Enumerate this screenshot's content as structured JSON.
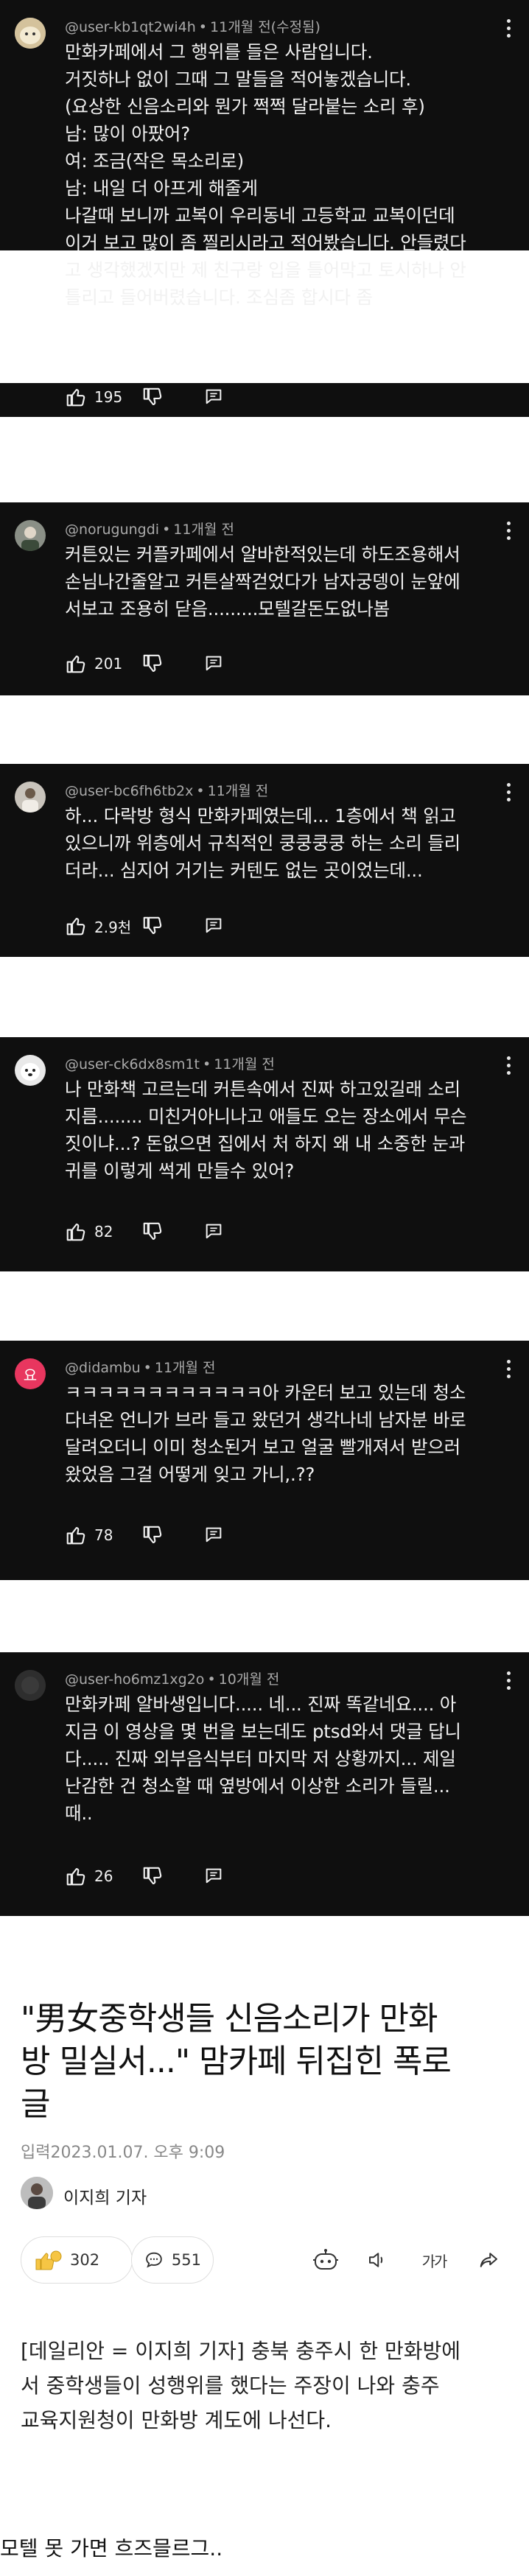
{
  "comments": [
    {
      "handle": "@user-kb1qt2wi4h",
      "time": "11개월 전(수정됨)",
      "lines": [
        "만화카페에서 그 행위를 들은 사람입니다.",
        "거짓하나 없이 그때 그 말들을 적어놓겠습니다.",
        "(요상한 신음소리와 뭔가 쩍쩍 달라붙는 소리 후)",
        "남: 많이 아팠어?",
        "여: 조금(작은 목소리로)",
        "남: 내일 더 아프게 해줄게",
        "나갈때 보니까 교복이 우리동네 고등학교 교복이던데",
        "이거 보고 많이 좀 찔리시라고 적어봤습니다. 안들렸다",
        "고 생각했겠지만 제 친구랑 입을 틀어막고 토시하나 안",
        "틀리고 들어버렸습니다. 조심좀 합시다 좀"
      ],
      "likes": "195"
    },
    {
      "handle": "@norugungdi",
      "time": "11개월 전",
      "lines": [
        "커튼있는 커플카페에서 알바한적있는데 하도조용해서",
        "손님나간줄알고 커튼살짝걷었다가 남자궁뎅이 눈앞에",
        "서보고 조용히 닫음.........모텔갈돈도없나봄"
      ],
      "likes": "201"
    },
    {
      "handle": "@user-bc6fh6tb2x",
      "time": "11개월 전",
      "lines": [
        "하... 다락방 형식 만화카페였는데... 1층에서 책 읽고",
        "있으니까 위층에서 규칙적인 쿵쿵쿵쿵 하는 소리 들리",
        "더라... 심지어 거기는 커텐도 없는 곳이었는데..."
      ],
      "likes": "2.9천"
    },
    {
      "handle": "@user-ck6dx8sm1t",
      "time": "11개월 전",
      "lines": [
        "나 만화책 고르는데 커튼속에서 진짜 하고있길래 소리",
        "지름........ 미친거아니나고 애들도 오는 장소에서 무슨",
        "짓이냐...? 돈없으면 집에서 처 하지 왜 내 소중한 눈과",
        "귀를 이렇게 썩게 만들수 있어?"
      ],
      "likes": "82"
    },
    {
      "handle": "@didambu",
      "time": "11개월 전",
      "avatar_letter": "요",
      "lines": [
        "ㅋㅋㅋㅋㅋㅋㅋㅋㅋㅋㅋㅋ아 카운터 보고 있는데 청소",
        "다녀온 언니가 브라 들고 왔던거 생각나네 남자분 바로",
        "달려오더니 이미 청소된거 보고 얼굴 빨개져서 받으러",
        "왔었음 그걸 어떻게 잊고 가니,.??"
      ],
      "likes": "78"
    },
    {
      "handle": "@user-ho6mz1xg2o",
      "time": "10개월 전",
      "lines": [
        "만화카페 알바생입니다..... 네... 진짜 똑같네요.... 아",
        "지금 이 영상을 몇 번을 보는데도 ptsd와서 댓글 답니",
        "다..... 진짜 외부음식부터 마지막 저 상황까지... 제일",
        "난감한 건 청소할 때 옆방에서 이상한 소리가 들릴...",
        "때.."
      ],
      "likes": "26"
    }
  ],
  "article": {
    "headline_lines": [
      "\"男女중학생들 신음소리가 만화",
      "방 밀실서...\" 맘카페 뒤집힌 폭로",
      "글"
    ],
    "dateline": "입력2023.01.07. 오후 9:09",
    "reporter": "이지희 기자",
    "reaction_count": "302",
    "comment_count": "551",
    "text_size_label": "가가",
    "lede_lines": [
      "[데일리안 = 이지희 기자] 충북 충주시 한 만화방에",
      "서 중학생들이 성행위를 했다는 주장이 나와 충주",
      "교육지원청이 만화방 계도에 나선다."
    ]
  },
  "caption": "모텔 못 가면 흐즈믈르그..",
  "colors": {
    "card_bg": "#0f0f0f",
    "text_light": "#f1f1f1",
    "meta_gray": "#aaaaaa",
    "avatar_pink": "#e8365f"
  }
}
